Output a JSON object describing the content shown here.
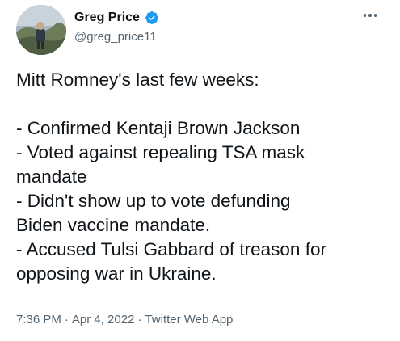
{
  "author": {
    "name": "Greg Price",
    "handle": "@greg_price11",
    "verified": true,
    "verified_color": "#1d9bf0"
  },
  "menu_icon": "more-horizontal-icon",
  "tweet": {
    "lines": [
      "Mitt Romney's last few weeks:",
      "",
      "- Confirmed Kentaji Brown Jackson",
      "- Voted against repealing TSA mask",
      "mandate",
      "- Didn't show up to vote defunding",
      "Biden vaccine mandate.",
      "- Accused Tulsi Gabbard of treason for",
      "opposing war in Ukraine."
    ]
  },
  "meta": {
    "time": "7:36 PM",
    "separator": "·",
    "date": "Apr 4, 2022",
    "source": "Twitter Web App"
  },
  "colors": {
    "text": "#0f1419",
    "secondary": "#536471",
    "background": "#ffffff"
  }
}
